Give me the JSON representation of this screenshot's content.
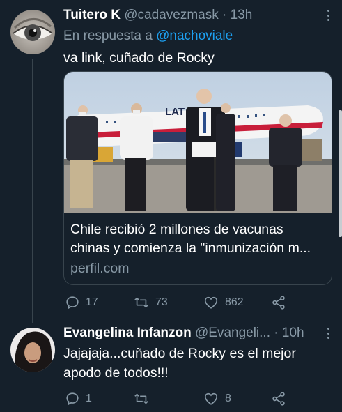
{
  "tweets": [
    {
      "author_name": "Tuitero K",
      "handle": "@cadavezmask",
      "separator": "·",
      "time": "13h",
      "reply_prefix": "En respuesta a",
      "reply_handle": "@nachoviale",
      "text": "va link, cuñado de Rocky",
      "card": {
        "title_line1": "Chile recibió 2 millones de vacunas",
        "title_line2": "chinas y comienza la \"inmunización m...",
        "domain": "perfil.com"
      },
      "replies": "17",
      "retweets": "73",
      "likes": "862"
    },
    {
      "author_name": "Evangelina Infanzon",
      "handle": "@Evangeli...",
      "separator": "·",
      "time": "10h",
      "text_line1": "Jajajaja...cuñado de Rocky es el mejor",
      "text_line2": "apodo de todos!!!",
      "replies": "1",
      "retweets": "",
      "likes": "8"
    }
  ],
  "icons": {
    "reply": "comment-icon",
    "retweet": "retweet-icon",
    "like": "heart-icon",
    "share": "share-icon",
    "more": "more-options-icon"
  },
  "colors": {
    "background": "#15202b",
    "secondary_text": "#8899a6",
    "link": "#1da1f2",
    "border": "#38444d"
  }
}
